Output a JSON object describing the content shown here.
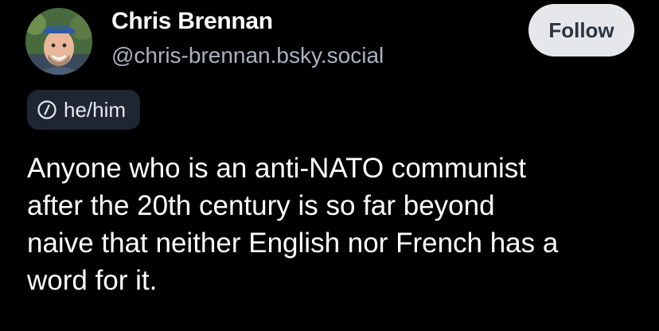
{
  "author": {
    "display_name": "Chris Brennan",
    "handle": "@chris-brennan.bsky.social",
    "avatar_icon": "person-photo-avatar"
  },
  "actions": {
    "follow_label": "Follow"
  },
  "pronouns": {
    "icon": "slash-circle-icon",
    "label": "he/him"
  },
  "post": {
    "text": "Anyone who is an anti-NATO communist\nafter the 20th century is so far beyond\nnaive that neither English nor French has a\nword for it."
  },
  "colors": {
    "background": "#000000",
    "text_primary": "#ffffff",
    "text_secondary": "#a8b3c2",
    "follow_bg": "#e5e7eb",
    "follow_text": "#2b3440",
    "pill_bg": "#1e2632"
  }
}
